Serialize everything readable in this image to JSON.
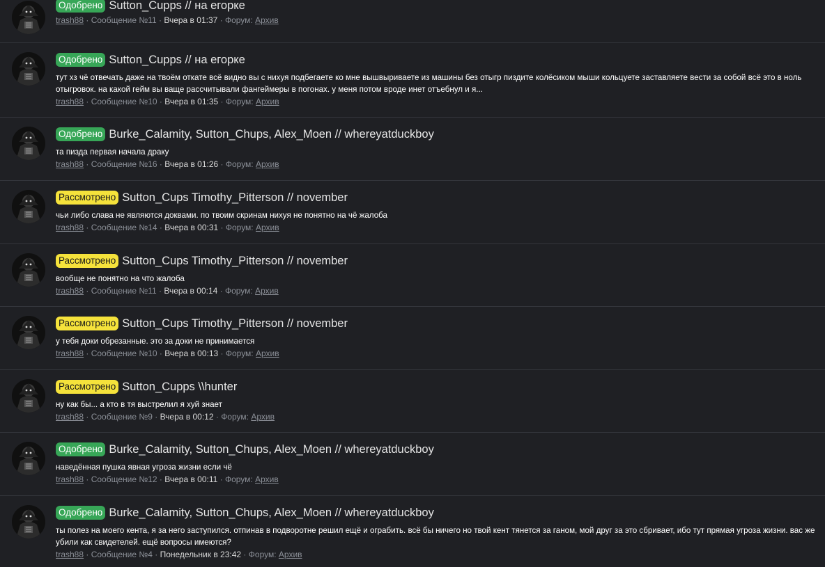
{
  "items": [
    {
      "status": "Одобрено",
      "status_type": "approved",
      "title": "Sutton_Cupps // на егорке",
      "snippet": "",
      "author": "trash88",
      "post": "Сообщение №11",
      "date": "Вчера в 01:37",
      "forum_label": "Форум:",
      "forum": "Архив"
    },
    {
      "status": "Одобрено",
      "status_type": "approved",
      "title": "Sutton_Cupps // на егорке",
      "snippet": "тут хз чё отвечать даже на твоём откате всё видно вы с нихуя подбегаете ко мне вышвыриваете из машины без отыгр пиздите колёсиком мыши кольцуете заставляете вести за собой всё это в ноль отыгровок. на какой гейм вы ваще рассчитывали фангеймеры в погонах. у меня потом вроде инет отъебнул и я...",
      "author": "trash88",
      "post": "Сообщение №10",
      "date": "Вчера в 01:35",
      "forum_label": "Форум:",
      "forum": "Архив"
    },
    {
      "status": "Одобрено",
      "status_type": "approved",
      "title": "Burke_Calamity, Sutton_Chups, Alex_Moen // whereyatduckboy",
      "snippet": "та пизда первая начала драку",
      "author": "trash88",
      "post": "Сообщение №16",
      "date": "Вчера в 01:26",
      "forum_label": "Форум:",
      "forum": "Архив"
    },
    {
      "status": "Рассмотрено",
      "status_type": "reviewed",
      "title": "Sutton_Cups Timothy_Pitterson // november",
      "snippet": "чьи либо слава не являются доквами. по твоим скринам нихуя не понятно на чё жалоба",
      "author": "trash88",
      "post": "Сообщение №14",
      "date": "Вчера в 00:31",
      "forum_label": "Форум:",
      "forum": "Архив"
    },
    {
      "status": "Рассмотрено",
      "status_type": "reviewed",
      "title": "Sutton_Cups Timothy_Pitterson // november",
      "snippet": "вообще не понятно на что жалоба",
      "author": "trash88",
      "post": "Сообщение №11",
      "date": "Вчера в 00:14",
      "forum_label": "Форум:",
      "forum": "Архив"
    },
    {
      "status": "Рассмотрено",
      "status_type": "reviewed",
      "title": "Sutton_Cups Timothy_Pitterson // november",
      "snippet": "у тебя доки обрезанные. это за доки не принимается",
      "author": "trash88",
      "post": "Сообщение №10",
      "date": "Вчера в 00:13",
      "forum_label": "Форум:",
      "forum": "Архив"
    },
    {
      "status": "Рассмотрено",
      "status_type": "reviewed",
      "title": "Sutton_Cupps \\\\hunter",
      "snippet": "ну как бы... а кто в тя выстрелил я хуй знает",
      "author": "trash88",
      "post": "Сообщение №9",
      "date": "Вчера в 00:12",
      "forum_label": "Форум:",
      "forum": "Архив"
    },
    {
      "status": "Одобрено",
      "status_type": "approved",
      "title": "Burke_Calamity, Sutton_Chups, Alex_Moen // whereyatduckboy",
      "snippet": "наведённая пушка явная угроза жизни если чё",
      "author": "trash88",
      "post": "Сообщение №12",
      "date": "Вчера в 00:11",
      "forum_label": "Форум:",
      "forum": "Архив"
    },
    {
      "status": "Одобрено",
      "status_type": "approved",
      "title": "Burke_Calamity, Sutton_Chups, Alex_Moen // whereyatduckboy",
      "snippet": "ты полез на моего кента, я за него заступился. отпинав в подворотне решил ещё и ограбить. всё бы ничего но твой кент тянется за ганом, мой друг за это сбривает, ибо тут прямая угроза жизни. вас же убили как свидетелей. ещё вопросы имеются?",
      "author": "trash88",
      "post": "Сообщение №4",
      "date": "Понедельник в 23:42",
      "forum_label": "Форум:",
      "forum": "Архив"
    }
  ]
}
